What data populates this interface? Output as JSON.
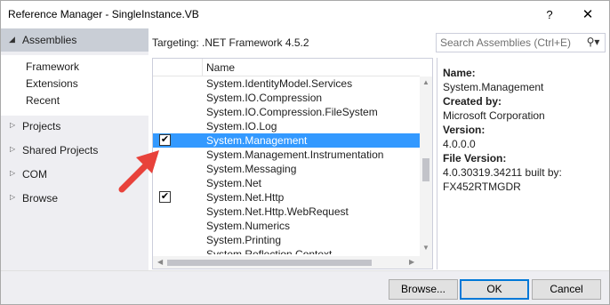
{
  "window": {
    "title": "Reference Manager - SingleInstance.VB",
    "help_label": "?",
    "close_label": "✕"
  },
  "sidebar": {
    "selected": {
      "label": "Assemblies"
    },
    "subitems": [
      "Framework",
      "Extensions",
      "Recent"
    ],
    "items": [
      "Projects",
      "Shared Projects",
      "COM",
      "Browse"
    ]
  },
  "targeting": "Targeting: .NET Framework 4.5.2",
  "search": {
    "placeholder": "Search Assemblies (Ctrl+E)",
    "icon": "search-icon"
  },
  "list": {
    "header_name": "Name",
    "rows": [
      {
        "name": "System.IdentityModel.Services",
        "checked": false,
        "selected": false
      },
      {
        "name": "System.IO.Compression",
        "checked": false,
        "selected": false
      },
      {
        "name": "System.IO.Compression.FileSystem",
        "checked": false,
        "selected": false
      },
      {
        "name": "System.IO.Log",
        "checked": false,
        "selected": false
      },
      {
        "name": "System.Management",
        "checked": true,
        "selected": true
      },
      {
        "name": "System.Management.Instrumentation",
        "checked": false,
        "selected": false
      },
      {
        "name": "System.Messaging",
        "checked": false,
        "selected": false
      },
      {
        "name": "System.Net",
        "checked": false,
        "selected": false
      },
      {
        "name": "System.Net.Http",
        "checked": true,
        "selected": false
      },
      {
        "name": "System.Net.Http.WebRequest",
        "checked": false,
        "selected": false
      },
      {
        "name": "System.Numerics",
        "checked": false,
        "selected": false
      },
      {
        "name": "System.Printing",
        "checked": false,
        "selected": false
      },
      {
        "name": "System.Reflection.Context",
        "checked": false,
        "selected": false
      }
    ]
  },
  "details": {
    "name_label": "Name:",
    "name_value": "System.Management",
    "created_label": "Created by:",
    "created_value": "Microsoft Corporation",
    "version_label": "Version:",
    "version_value": "4.0.0.0",
    "file_version_label": "File Version:",
    "file_version_value_1": "4.0.30319.34211 built by:",
    "file_version_value_2": "FX452RTMGDR"
  },
  "footer": {
    "browse_label": "Browse...",
    "ok_label": "OK",
    "cancel_label": "Cancel"
  },
  "colors": {
    "selection": "#3399ff",
    "annotation_arrow": "#e8423b",
    "ok_border": "#0078d7"
  }
}
